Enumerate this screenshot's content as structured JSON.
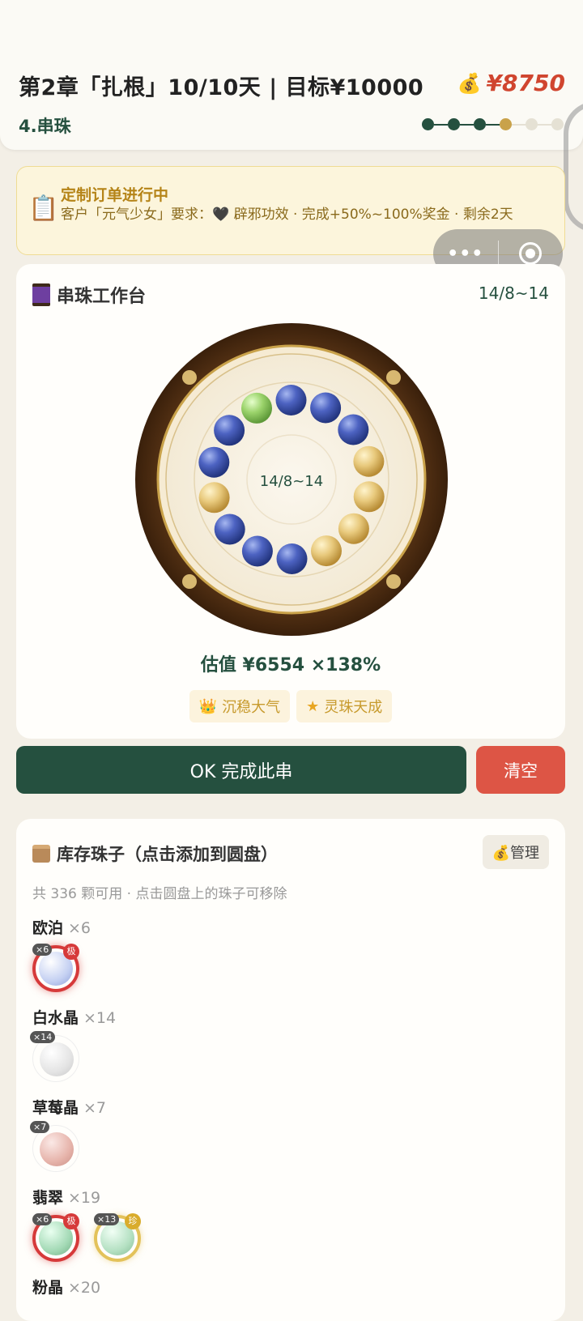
{
  "header": {
    "title": "第2章「扎根」10/10天 | 目标¥10000",
    "money": "¥8750",
    "step": "4.串珠",
    "progress": {
      "total": 6,
      "done": 3,
      "current": 4
    }
  },
  "order": {
    "title": "定制订单进行中",
    "text": "客户「元气少女」要求：🖤 辟邪功效 · 完成+50%~100%奖金 · 剩余2天"
  },
  "bench": {
    "title": "串珠工作台",
    "count": "14/8~14",
    "center_count": "14/8~14",
    "beads": [
      "green",
      "blue",
      "blue",
      "blue",
      "gold",
      "gold",
      "gold",
      "gold",
      "blue",
      "blue",
      "blue",
      "gold",
      "blue",
      "blue"
    ],
    "estimate": "估值 ¥6554 ×138%",
    "tags": [
      {
        "icon": "👑",
        "label": "沉稳大气"
      },
      {
        "icon": "★",
        "label": "灵珠天成"
      }
    ]
  },
  "actions": {
    "ok": "OK 完成此串",
    "clear": "清空"
  },
  "inventory": {
    "title": "库存珠子（点击添加到圆盘）",
    "manage": "💰管理",
    "subtitle": "共 336 颗可用 · 点击圆盘上的珠子可移除",
    "groups": [
      {
        "name": "欧泊",
        "count": "×6",
        "items": [
          {
            "qty": "×6",
            "level": "极"
          }
        ]
      },
      {
        "name": "白水晶",
        "count": "×14",
        "items": [
          {
            "qty": "×14",
            "level": ""
          }
        ]
      },
      {
        "name": "草莓晶",
        "count": "×7",
        "items": [
          {
            "qty": "×7",
            "level": ""
          }
        ]
      },
      {
        "name": "翡翠",
        "count": "×19",
        "items": [
          {
            "qty": "×6",
            "level": "极"
          },
          {
            "qty": "×13",
            "level": "珍"
          }
        ]
      },
      {
        "name": "粉晶",
        "count": "×20",
        "items": []
      }
    ]
  },
  "colors": {
    "primary": "#25503f",
    "danger": "#dd5545",
    "money": "#d0452f",
    "gold": "#c9a24a"
  }
}
